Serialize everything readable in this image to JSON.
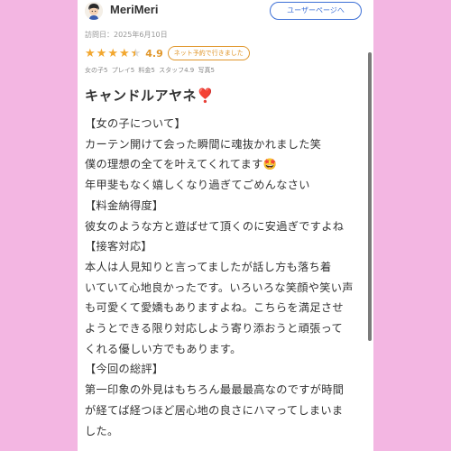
{
  "user": {
    "name": "MeriMeri",
    "page_button": "ユーザーページへ"
  },
  "visit": {
    "date_label": "訪問日：2025年6月10日"
  },
  "rating": {
    "value": "4.9",
    "stars": 4.5,
    "badge": "ネット予約で行きました"
  },
  "subscores": [
    "女の子5",
    "プレイ5",
    "料金5",
    "スタッフ4.9",
    "写真5"
  ],
  "review": {
    "title": "キャンドルアヤネ❣️",
    "lines": [
      "【女の子について】",
      "カーテン開けて会った瞬間に魂抜かれました笑",
      "僕の理想の全てを叶えてくれてます🤩",
      "年甲斐もなく嬉しくなり過ぎてごめんなさい",
      "【料金納得度】",
      "彼女のような方と遊ばせて頂くのに安過ぎですよね",
      "【接客対応】",
      "本人は人見知りと言ってましたが話し方も落ち着",
      "いていて心地良かったです。いろいろな笑顔や笑い声",
      "も可愛くて愛嬌もありますよね。こちらを満足させ",
      "ようとできる限り対応しよう寄り添おうと頑張って",
      "くれる優しい方でもあります。",
      "【今回の総評】",
      "第一印象の外見はもちろん最最最高なのですが時間",
      "が経てば経つほど居心地の良さにハマってしまいま",
      "した。"
    ]
  },
  "colors": {
    "page_background": "#f3b6e2",
    "star": "#f2a72f",
    "accent_blue": "#3c6fd6"
  }
}
